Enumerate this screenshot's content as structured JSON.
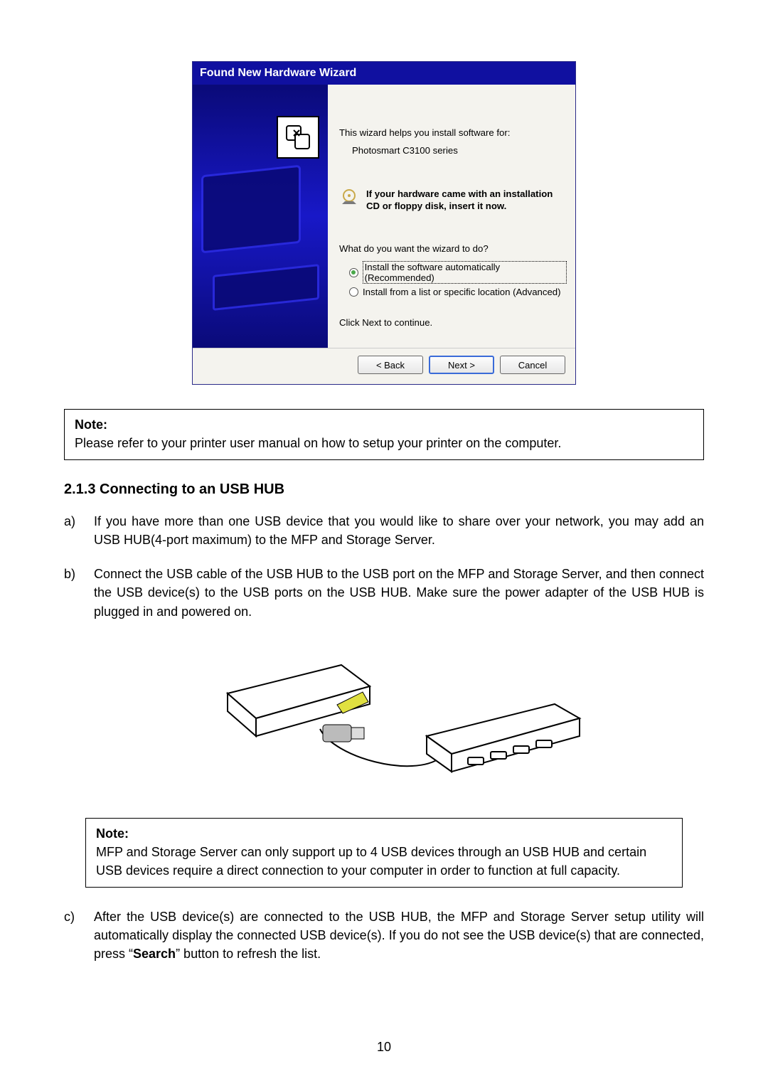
{
  "wizard": {
    "title": "Found New Hardware Wizard",
    "intro": "This wizard helps you install software for:",
    "device": "Photosmart C3100 series",
    "cd_hint": "If your hardware came with an installation CD or floppy disk, insert it now.",
    "question": "What do you want the wizard to do?",
    "radio_auto": "Install the software automatically (Recommended)",
    "radio_manual": "Install from a list or specific location (Advanced)",
    "continue": "Click Next to continue.",
    "back": "< Back",
    "next": "Next >",
    "cancel": "Cancel"
  },
  "note1_title": "Note:",
  "note1_body": "Please refer to your printer user manual on how to setup your printer on the computer.",
  "section_heading": "2.1.3  Connecting to an USB HUB",
  "bullets": {
    "a": "If you have more than one USB device that you would like to share over your network, you may add an USB HUB(4-port maximum) to the MFP and Storage Server.",
    "b": "Connect the USB cable of the USB HUB to the USB port on the MFP and Storage Server, and then connect the USB device(s) to the USB ports on the USB HUB. Make sure the power adapter of the USB HUB is plugged in and powered on.",
    "c_prefix": "After the USB device(s) are connected to the USB HUB, the MFP and Storage Server setup utility will automatically display the connected USB device(s). If you do not see the USB device(s) that are connected, press “",
    "c_bold": "Search",
    "c_suffix": "” button to refresh the list."
  },
  "note2_title": "Note:",
  "note2_body": "MFP and Storage Server can only support up to 4 USB devices through an USB HUB and certain USB devices require a direct connection to your computer in order to function at full capacity.",
  "page_number": "10"
}
